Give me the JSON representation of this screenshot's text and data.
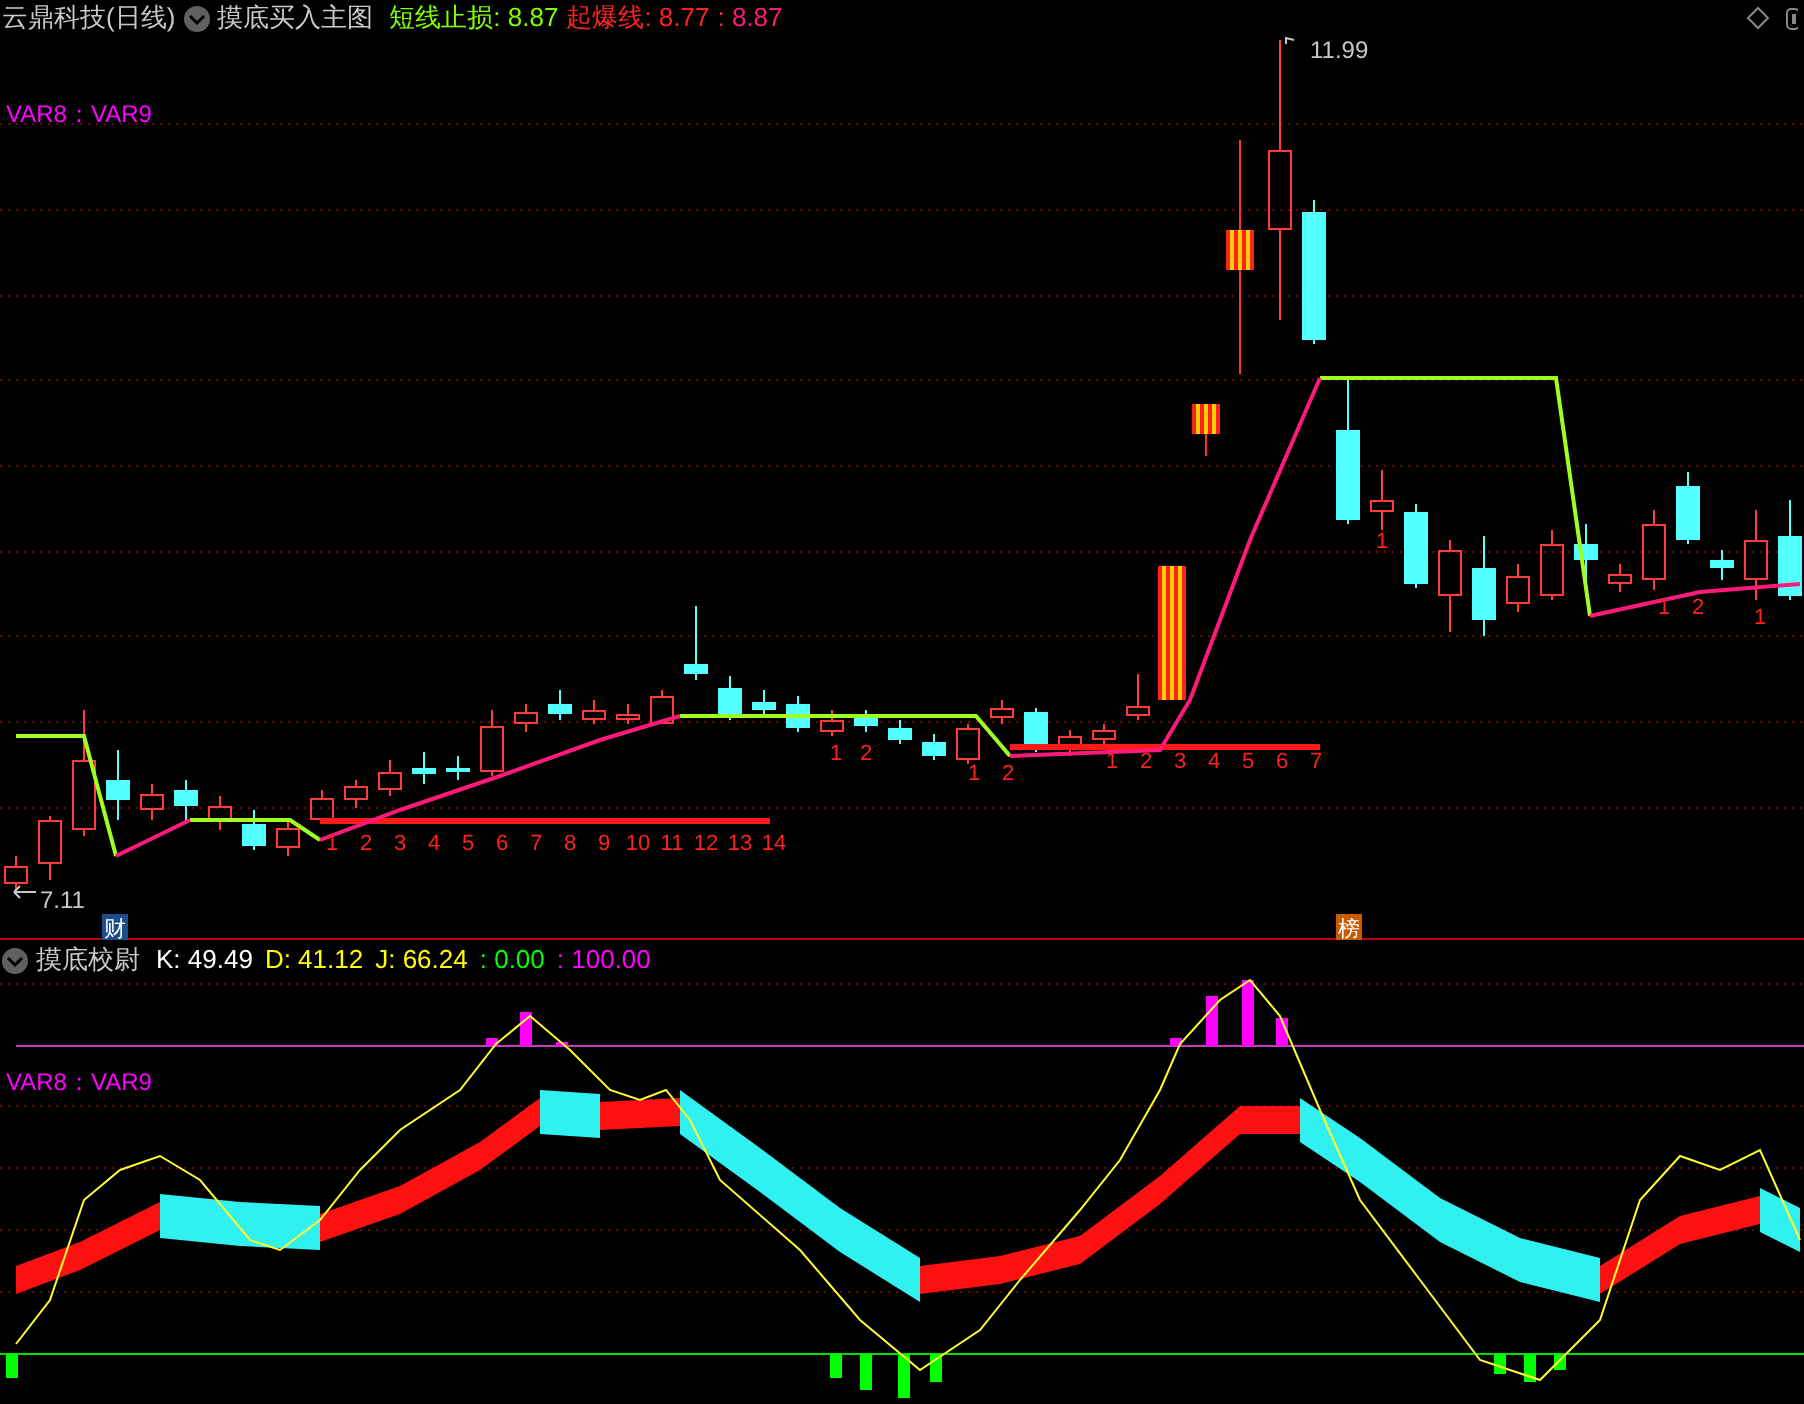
{
  "main_panel": {
    "stock_title": "云鼎科技(日线)",
    "indicator_name": "摸底买入主图",
    "fields": [
      {
        "label": "短线止损:",
        "value": "8.87",
        "color": "#80ff00"
      },
      {
        "label": "起爆线:",
        "value": "8.77",
        "color": "#ff2020"
      },
      {
        "label": ":",
        "value": "8.87",
        "color": "#ff1a7a"
      }
    ],
    "legend": "VAR8：VAR9",
    "high_label": "11.99",
    "low_label": "7.11",
    "badges": [
      "财",
      "榜"
    ],
    "count_rows": [
      {
        "labels": [
          "1",
          "2",
          "3",
          "4",
          "5",
          "6",
          "7",
          "8",
          "9",
          "10",
          "11",
          "12",
          "13",
          "14"
        ]
      },
      {
        "labels": [
          "1",
          "2"
        ]
      },
      {
        "labels": [
          "1",
          "2"
        ]
      },
      {
        "labels": [
          "1",
          "2",
          "3",
          "4",
          "5",
          "6",
          "7"
        ]
      },
      {
        "labels": [
          "1"
        ]
      },
      {
        "labels": [
          "1",
          "2"
        ]
      },
      {
        "labels": [
          "1"
        ]
      }
    ]
  },
  "lower_panel": {
    "indicator_name": "摸底校尉",
    "fields": [
      {
        "label": "K:",
        "value": "49.49",
        "color": "#ffffff"
      },
      {
        "label": "D:",
        "value": "41.12",
        "color": "#ffff00"
      },
      {
        "label": "J:",
        "value": "66.24",
        "color": "#ffff00"
      },
      {
        "label": ":",
        "value": "0.00",
        "color": "#00ff00"
      },
      {
        "label": ":",
        "value": "100.00",
        "color": "#ff00ff"
      }
    ],
    "legend": "VAR8：VAR9"
  }
}
